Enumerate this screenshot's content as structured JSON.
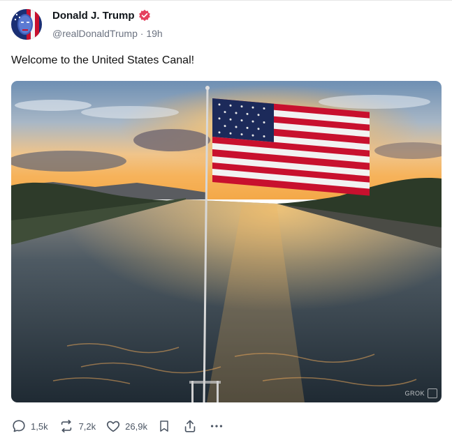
{
  "post": {
    "author": {
      "display_name": "Donald J. Trump",
      "handle": "@realDonaldTrump",
      "separator": "·",
      "time": "19h",
      "verified_icon": "verified-badge-icon"
    },
    "text": "Welcome to the United States Canal!",
    "media": {
      "watermark": "GROK"
    },
    "actions": {
      "replies": "1,5k",
      "reposts": "7,2k",
      "likes": "26,9k"
    }
  },
  "colors": {
    "text": "#0f1419",
    "muted": "#6b7280",
    "verified": "#e5405e",
    "flag_red": "#c8102e",
    "flag_blue": "#1c2a5a"
  }
}
